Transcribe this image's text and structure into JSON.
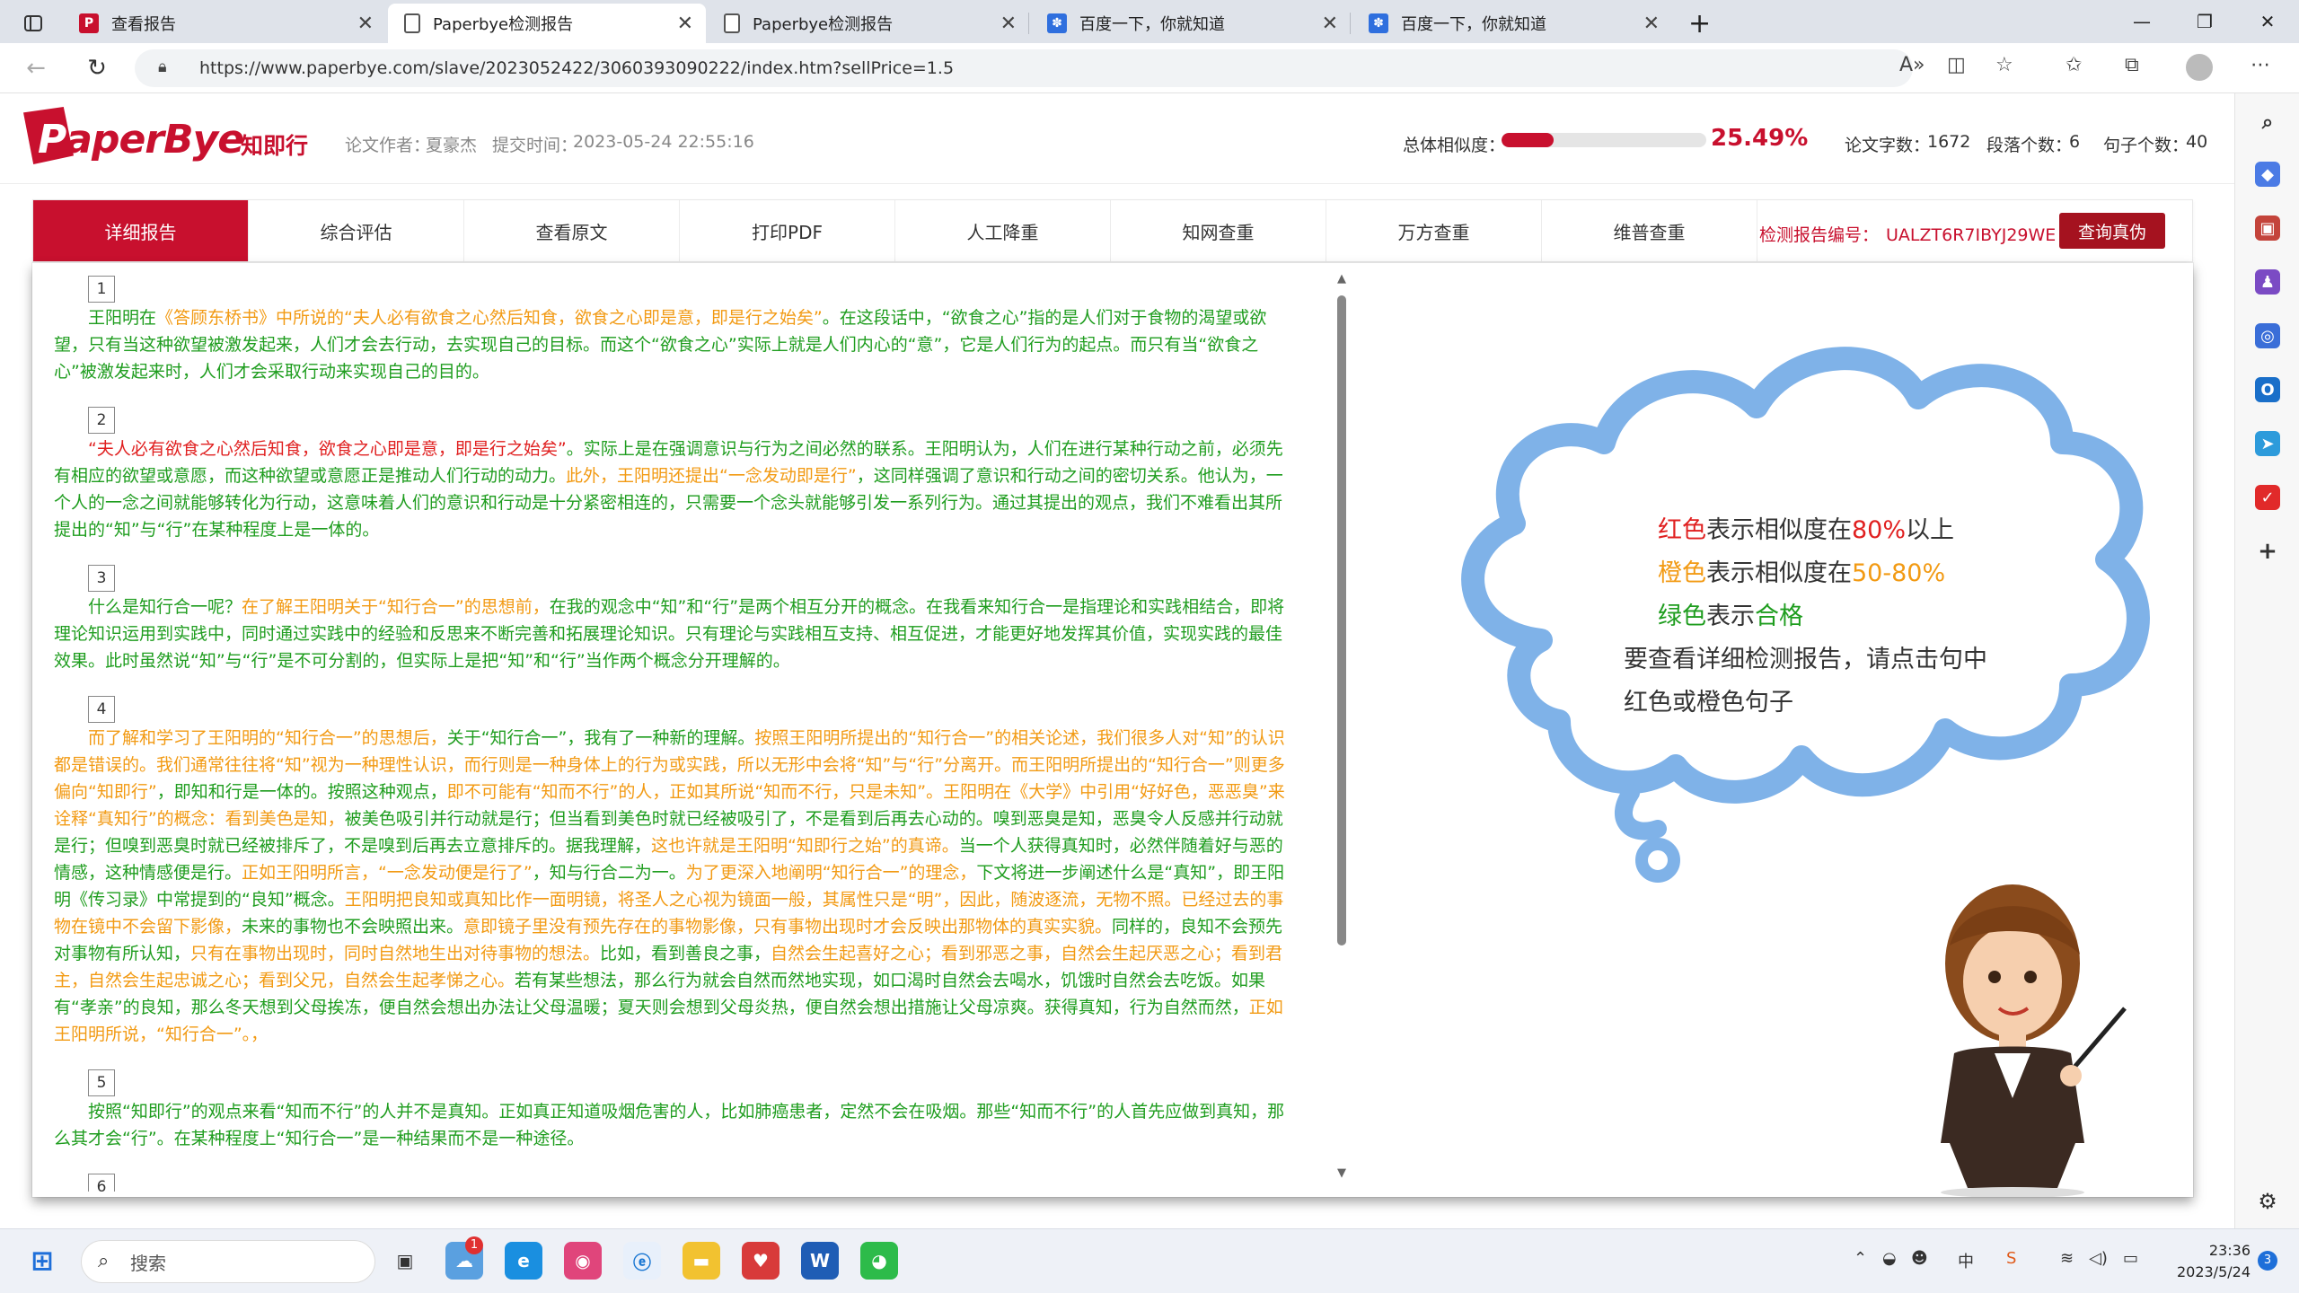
{
  "browser": {
    "tabs": [
      {
        "title": "查看报告",
        "icon": "paperbye-red-icon",
        "active": false
      },
      {
        "title": "Paperbye检测报告",
        "icon": "page-icon",
        "active": true
      },
      {
        "title": "Paperbye检测报告",
        "icon": "page-icon",
        "active": false
      },
      {
        "title": "百度一下，你就知道",
        "icon": "baidu-paw-icon",
        "active": false
      },
      {
        "title": "百度一下，你就知道",
        "icon": "baidu-paw-icon",
        "active": false
      }
    ],
    "new_tab": "+",
    "url": "https://www.paperbye.com/slave/2023052422/3060393090222/index.htm?sellPrice=1.5"
  },
  "header": {
    "logo_p": "P",
    "logo_rest": "aperBye",
    "brand": "知即行",
    "author_label": "论文作者：",
    "author": "夏豪杰",
    "time_label": "提交时间：",
    "time": "2023-05-24 22:55:16",
    "similarity_label": "总体相似度：",
    "similarity_value": "25.49%",
    "similarity_fraction": 0.2549,
    "word_count_label": "论文字数：",
    "word_count": "1672",
    "para_count_label": "段落个数：",
    "para_count": "6",
    "sentence_count_label": "句子个数：",
    "sentence_count": "40"
  },
  "menu": {
    "items": [
      "详细报告",
      "综合评估",
      "查看原文",
      "打印PDF",
      "人工降重",
      "知网查重",
      "万方查重",
      "维普查重"
    ],
    "report_no_label": "检测报告编号：",
    "report_no": "UALZT6R7IBYJ29WE",
    "query_button": "查询真伪"
  },
  "paragraphs": [
    {
      "num": "1",
      "segments": [
        {
          "c": "g",
          "t": "王阳明在"
        },
        {
          "c": "o",
          "t": "《答顾东桥书》中所说的“夫人必有欲食之心然后知食，欲食之心即是意，即是行之始矣”"
        },
        {
          "c": "g",
          "t": "。在这段话中，“欲食之心”指的是人们对于食物的渴望或欲望，只有当这种欲望被激发起来，人们才会去行动，去实现自己的目标。而这个“欲食之心”实际上就是人们内心的“意”，它是人们行为的起点。而只有当“欲食之心”被激发起来时，人们才会采取行动来实现自己的目的。"
        }
      ]
    },
    {
      "num": "2",
      "segments": [
        {
          "c": "r",
          "t": "“夫人必有欲食之心然后知食，欲食之心即是意，即是行之始矣”"
        },
        {
          "c": "g",
          "t": "。实际上是在强调意识与行为之间必然的联系。王阳明认为，人们在进行某种行动之前，必须先有相应的欲望或意愿，而这种欲望或意愿正是推动人们行动的动力。"
        },
        {
          "c": "o",
          "t": "此外，王阳明还提出“一念发动即是行”"
        },
        {
          "c": "g",
          "t": "，这同样强调了意识和行动之间的密切关系。他认为，一个人的一念之间就能够转化为行动，这意味着人们的意识和行动是十分紧密相连的，只需要一个念头就能够引发一系列行为。通过其提出的观点，我们不难看出其所提出的“知”与“行”在某种程度上是一体的。"
        }
      ]
    },
    {
      "num": "3",
      "segments": [
        {
          "c": "g",
          "t": "什么是知行合一呢？"
        },
        {
          "c": "o",
          "t": "在了解王阳明关于“知行合一”的思想前，"
        },
        {
          "c": "g",
          "t": "在我的观念中“知”和“行”是两个相互分开的概念。在我看来知行合一是指理论和实践相结合，即将理论知识运用到实践中，同时通过实践中的经验和反思来不断完善和拓展理论知识。只有理论与实践相互支持、相互促进，才能更好地发挥其价值，实现实践的最佳效果。此时虽然说“知”与“行”是不可分割的，但实际上是把“知”和“行”当作两个概念分开理解的。"
        }
      ]
    },
    {
      "num": "4",
      "segments": [
        {
          "c": "o",
          "t": "而了解和学习了王阳明的“知行合一”的思想后，"
        },
        {
          "c": "g",
          "t": "关于“知行合一”，我有了一种新的理解。"
        },
        {
          "c": "o",
          "t": "按照王阳明所提出的“知行合一”的相关论述，我们很多人对“知”的认识都是错误的。我们通常往往将“知”视为一种理性认识，而行则是一种身体上的行为或实践，所以无形中会将“知”与“行”分离开。而王阳明所提出的“知行合一”则更多偏向“知即行”"
        },
        {
          "c": "g",
          "t": "，即知和行是一体的。按照这种观点，"
        },
        {
          "c": "o",
          "t": "即不可能有“知而不行”的人，正如其所说“知而不行，只是未知”。王阳明在《大学》中引用“好好色，恶恶臭”来诠释“真知行”的概念：看到美色是知，"
        },
        {
          "c": "g",
          "t": "被美色吸引并行动就是行；但当看到美色时就已经被吸引了，不是看到后再去心动的。嗅到恶臭是知，恶臭令人反感并行动就是行；但嗅到恶臭时就已经被排斥了，不是嗅到后再去立意排斥的。据我理解，"
        },
        {
          "c": "o",
          "t": "这也许就是王阳明“知即行之始”的真谛。"
        },
        {
          "c": "g",
          "t": "当一个人获得真知时，必然伴随着好与恶的情感，这种情感便是行。"
        },
        {
          "c": "o",
          "t": "正如王阳明所言，“一念发动便是行了”"
        },
        {
          "c": "g",
          "t": "，知与行合二为一。"
        },
        {
          "c": "o",
          "t": "为了更深入地阐明“知行合一”的理念，"
        },
        {
          "c": "g",
          "t": "下文将进一步阐述什么是“真知”，即王阳明《传习录》中常提到的“良知”概念。"
        },
        {
          "c": "o",
          "t": "王阳明把良知或真知比作一面明镜，将圣人之心视为镜面一般，其属性只是“明”，因此，随波逐流，无物不照。已经过去的事物在镜中不会留下影像，"
        },
        {
          "c": "g",
          "t": "未来的事物也不会映照出来。"
        },
        {
          "c": "o",
          "t": "意即镜子里没有预先存在的事物影像，只有事物出现时才会反映出那物体的真实实貌。"
        },
        {
          "c": "g",
          "t": "同样的，良知不会预先对事物有所认知，"
        },
        {
          "c": "o",
          "t": "只有在事物出现时，同时自然地生出对待事物的想法。"
        },
        {
          "c": "g",
          "t": "比如，看到善良之事，"
        },
        {
          "c": "o",
          "t": "自然会生起喜好之心；看到邪恶之事，自然会生起厌恶之心；看到君主，自然会生起忠诚之心；看到父兄，自然会生起孝悌之心。"
        },
        {
          "c": "g",
          "t": "若有某些想法，那么行为就会自然而然地实现，如口渴时自然会去喝水，饥饿时自然会去吃饭。如果有“孝亲”的良知，那么冬天想到父母挨冻，便自然会想出办法让父母温暖；夏天则会想到父母炎热，便自然会想出措施让父母凉爽。获得真知，行为自然而然，"
        },
        {
          "c": "o",
          "t": "正如王阳明所说，“知行合一”。，"
        }
      ]
    },
    {
      "num": "5",
      "segments": [
        {
          "c": "g",
          "t": "按照“知即行”的观点来看“知而不行”的人并不是真知。正如真正知道吸烟危害的人，比如肺癌患者，定然不会在吸烟。那些“知而不行”的人首先应做到真知，那么其才会“行”。在某种程度上“知行合一”是一种结果而不是一种途径。"
        }
      ]
    },
    {
      "num": "6",
      "segments": []
    }
  ],
  "legend": {
    "red_word": "红色",
    "red_mid": "表示相似度在",
    "red_pct": "80%",
    "red_end": "以上",
    "orange_word": "橙色",
    "orange_mid": "表示相似度在",
    "orange_pct": "50-80%",
    "green_word": "绿色",
    "green_mid": "表示",
    "green_end": "合格",
    "hint1": "要查看详细检测报告，请点击句中",
    "hint2": "红色或橙色句子"
  },
  "colors": {
    "brand": "#c8102e",
    "green": "#1f9d1f",
    "orange": "#f29a13",
    "red": "#e02020",
    "cloud": "#7fb2e8"
  },
  "taskbar": {
    "search_placeholder": "搜索",
    "badge": "1",
    "time": "23:36",
    "date": "2023/5/24",
    "notif": "3",
    "ime": "中"
  }
}
